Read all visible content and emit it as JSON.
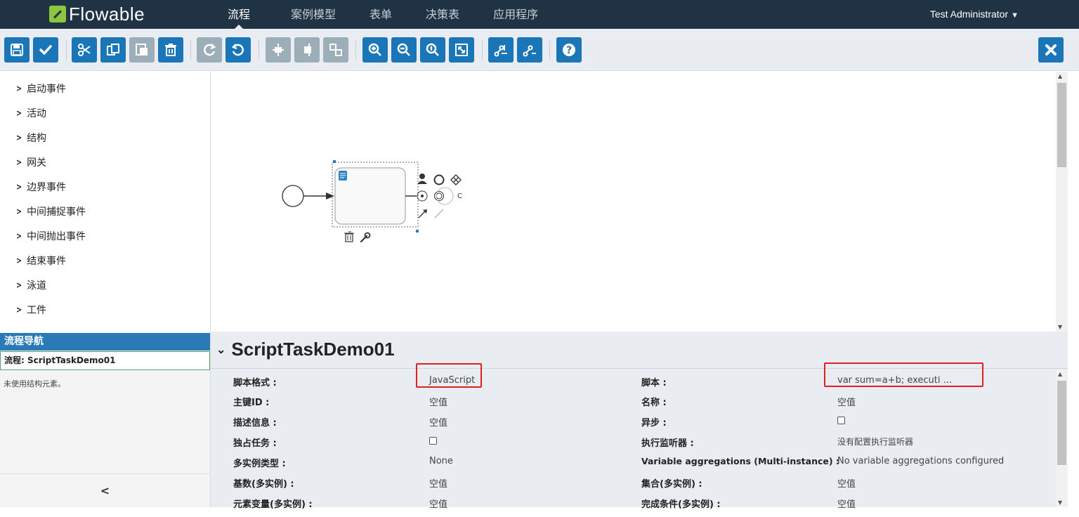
{
  "brand": {
    "name": "Flowable"
  },
  "nav": {
    "tabs": [
      "流程",
      "案例模型",
      "表单",
      "决策表",
      "应用程序"
    ],
    "user": "Test Administrator"
  },
  "toolbar": {
    "buttons": [
      "save-icon",
      "validate-icon",
      "cut-icon",
      "copy-icon",
      "paste-icon",
      "delete-icon",
      "redo-icon",
      "undo-icon",
      "align-vertical-icon",
      "align-horizontal-icon",
      "same-size-icon",
      "zoom-in-icon",
      "zoom-out-icon",
      "zoom-actual-icon",
      "zoom-fit-icon",
      "bend-point-add-icon",
      "bend-point-remove-icon",
      "help-icon",
      "close-icon"
    ]
  },
  "palette": {
    "items": [
      "启动事件",
      "活动",
      "结构",
      "网关",
      "边界事件",
      "中间捕捉事件",
      "中间抛出事件",
      "结束事件",
      "泳道",
      "工件"
    ]
  },
  "navigator": {
    "title": "流程导航",
    "process": "流程: ScriptTaskDemo01",
    "empty_text": "未使用结构元素。"
  },
  "properties": {
    "title": "ScriptTaskDemo01",
    "left": [
      {
        "label": "脚本格式 :",
        "value": "JavaScript"
      },
      {
        "label": "主键ID :",
        "value": "空值"
      },
      {
        "label": "描述信息 :",
        "value": "空值"
      },
      {
        "label": "独占任务 :",
        "value": ""
      },
      {
        "label": "多实例类型 :",
        "value": "None"
      },
      {
        "label": "基数(多实例) :",
        "value": "空值"
      },
      {
        "label": "元素变量(多实例) :",
        "value": "空值"
      }
    ],
    "right": [
      {
        "label": "脚本 :",
        "value": "var sum=a+b; executi ..."
      },
      {
        "label": "名称 :",
        "value": "空值"
      },
      {
        "label": "异步 :",
        "value": ""
      },
      {
        "label": "执行监听器 :",
        "value": "没有配置执行监听器"
      },
      {
        "label": "Variable aggregations (Multi-instance) :",
        "value": "No variable aggregations configured"
      },
      {
        "label": "集合(多实例) :",
        "value": "空值"
      },
      {
        "label": "完成条件(多实例) :",
        "value": "空值"
      }
    ]
  },
  "colors": {
    "navbar": "#1f3344",
    "accent": "#1b76b8",
    "highlight": "#e02020"
  }
}
